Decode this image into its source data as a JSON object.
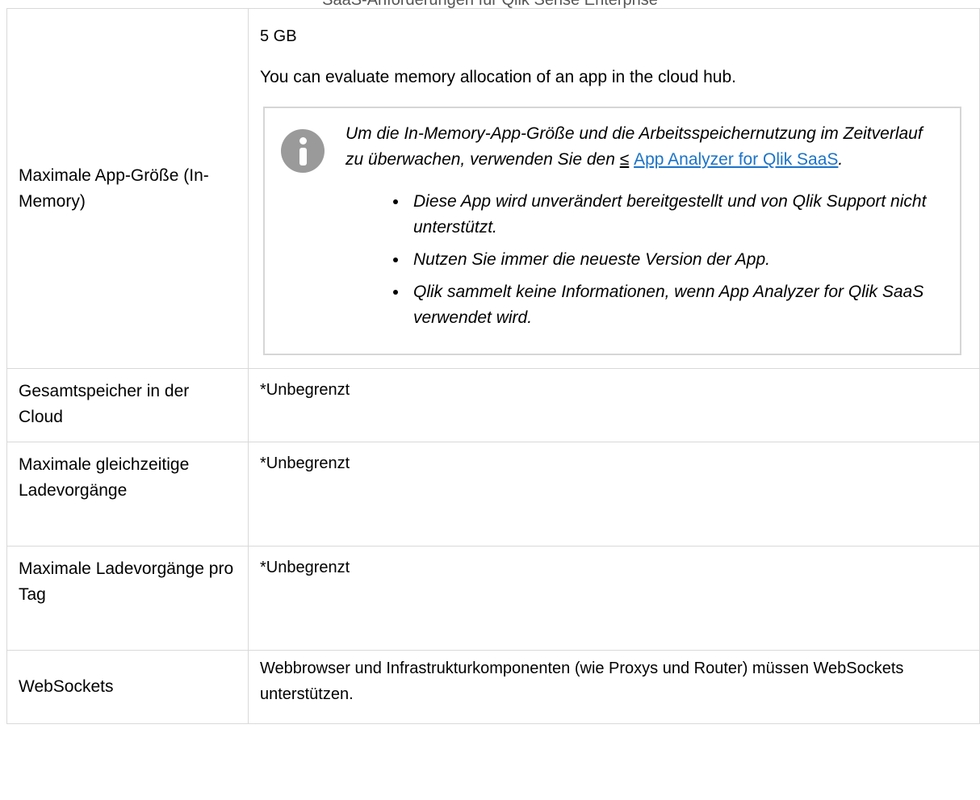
{
  "running_header": "SaaS-Anforderungen für Qlik Sense Enterprise",
  "rows": [
    {
      "label": "Maximale App-Größe (In-Memory)",
      "value": "5 GB",
      "paragraph": "You can evaluate memory allocation of an app in the cloud hub.",
      "note": {
        "icon": "info-icon",
        "text_before": "Um die In-Memory-App-Größe und die Arbeitsspeichernutzung im Zeitverlauf zu überwachen, verwenden Sie den ",
        "link_arrow": "≤",
        "link_text": "App Analyzer for Qlik SaaS",
        "text_after": ".",
        "bullets": [
          "Diese App wird unverändert bereitgestellt und von Qlik Support nicht unterstützt.",
          "Nutzen Sie immer die neueste Version der App.",
          "Qlik sammelt keine Informationen, wenn App Analyzer for Qlik SaaS verwendet wird."
        ]
      }
    },
    {
      "label": "Gesamtspeicher in der Cloud",
      "value": "*Unbegrenzt"
    },
    {
      "label": "Maximale gleichzeitige Ladevorgänge",
      "value": "*Unbegrenzt"
    },
    {
      "label": "Maximale Ladevorgänge pro Tag",
      "value": "*Unbegrenzt"
    },
    {
      "label": "WebSockets",
      "value": "Webbrowser und Infrastrukturkomponenten (wie Proxys und Router) müssen WebSockets unterstützen."
    }
  ]
}
